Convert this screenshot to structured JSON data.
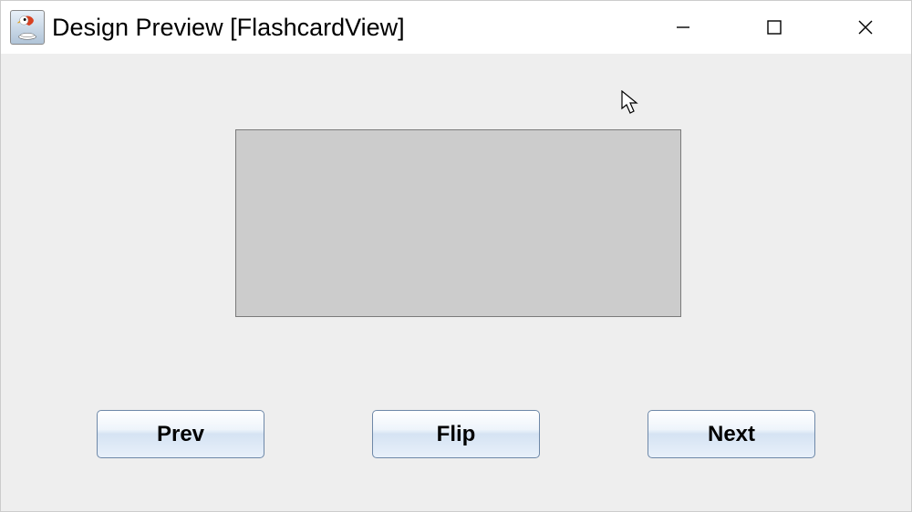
{
  "window": {
    "title": "Design Preview [FlashcardView]"
  },
  "buttons": {
    "prev": "Prev",
    "flip": "Flip",
    "next": "Next"
  }
}
